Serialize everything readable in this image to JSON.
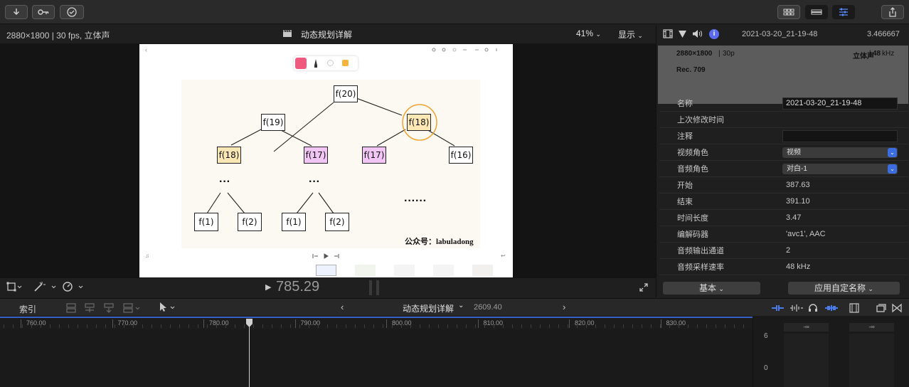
{
  "toolbar": {
    "left_icons": [
      "import-icon",
      "keywords-icon",
      "check-icon"
    ],
    "right_icons": [
      "browser-icon",
      "timeline-icon",
      "inspector-icon",
      "share-icon"
    ]
  },
  "viewer": {
    "format": "2880×1800 | 30 fps,  立体声",
    "title": "动态规划详解",
    "zoom": "41%",
    "display": "显示",
    "timecode": "785.29"
  },
  "diagram": {
    "nodes": [
      {
        "label": "f(20)",
        "fill": "#ffffff"
      },
      {
        "label": "f(19)",
        "fill": "#ffffff"
      },
      {
        "label": "f(18)",
        "fill": "#fde8b5"
      },
      {
        "label": "f(18)",
        "fill": "#f8e7b5"
      },
      {
        "label": "f(17)",
        "fill": "#f1c5f4"
      },
      {
        "label": "f(17)",
        "fill": "#f1c5f4"
      },
      {
        "label": "f(16)",
        "fill": "#ffffff"
      },
      {
        "label": "f(1)",
        "fill": "#ffffff"
      },
      {
        "label": "f(2)",
        "fill": "#ffffff"
      },
      {
        "label": "f(1)",
        "fill": "#ffffff"
      },
      {
        "label": "f(2)",
        "fill": "#ffffff"
      }
    ],
    "ellipsis_1": "···",
    "ellipsis_2": "···",
    "ellipsis_3": "······",
    "watermark": "公众号：labuladong"
  },
  "inspector": {
    "timestamp": "2021-03-20_21-19-48",
    "duration": "3.466667",
    "card": {
      "resolution": "2880×1800",
      "fps": "30p",
      "audio": "立体声",
      "sample": "48",
      "sample_unit": "kHz",
      "color": "Rec. 709"
    },
    "rows": [
      {
        "label": "名称",
        "value": "2021-03-20_21-19-48",
        "kind": "field"
      },
      {
        "label": "上次修改时间",
        "value": "",
        "kind": "text"
      },
      {
        "label": "注释",
        "value": "",
        "kind": "field"
      },
      {
        "label": "视频角色",
        "value": "视频",
        "kind": "select"
      },
      {
        "label": "音频角色",
        "value": "对白-1",
        "kind": "select"
      },
      {
        "label": "开始",
        "value": "387.63",
        "kind": "text"
      },
      {
        "label": "结束",
        "value": "391.10",
        "kind": "text"
      },
      {
        "label": "时间长度",
        "value": "3.47",
        "kind": "text"
      },
      {
        "label": "编解码器",
        "value": "'avc1', AAC",
        "kind": "text"
      },
      {
        "label": "音频输出通道",
        "value": "2",
        "kind": "text"
      },
      {
        "label": "音频采样速率",
        "value": "48 kHz",
        "kind": "text"
      }
    ],
    "basic_btn": "基本",
    "apply_btn": "应用自定名称"
  },
  "timeline": {
    "index_label": "索引",
    "project": "动态规划详解",
    "project_duration": "2609.40",
    "ruler": [
      "760.00",
      "770.00",
      "780.00",
      "790.00",
      "800.00",
      "810.00",
      "820.00",
      "830.00"
    ],
    "meter_top": "6",
    "meter_zero": "0",
    "meter_inf_l": "-∞",
    "meter_inf_r": "-∞"
  },
  "colors": {
    "accent": "#3a6fe0",
    "playhead": "#cfcfcf",
    "highlight_circle": "#f0a330"
  }
}
